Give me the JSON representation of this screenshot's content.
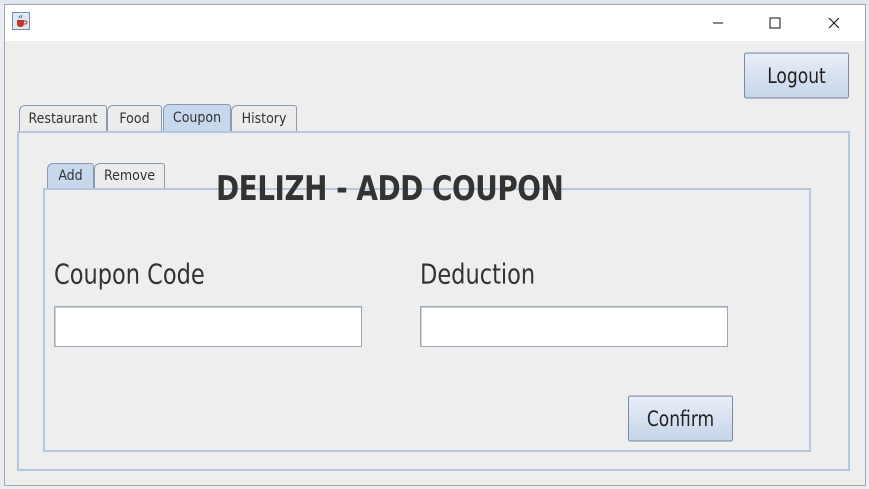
{
  "window": {
    "title": "",
    "controls": [
      "minimize-icon",
      "maximize-icon",
      "close-icon"
    ]
  },
  "header": {
    "logout_label": "Logout"
  },
  "main_tabs": [
    {
      "label": "Restaurant",
      "selected": false
    },
    {
      "label": "Food",
      "selected": false
    },
    {
      "label": "Coupon",
      "selected": true
    },
    {
      "label": "History",
      "selected": false
    }
  ],
  "sub_tabs": [
    {
      "label": "Add",
      "selected": true
    },
    {
      "label": "Remove",
      "selected": false
    }
  ],
  "form": {
    "heading": "DELIZH - ADD COUPON",
    "coupon_code_label": "Coupon Code",
    "coupon_code_value": "",
    "deduction_label": "Deduction",
    "deduction_value": "",
    "confirm_label": "Confirm"
  },
  "colors": {
    "tab_selected": "#c7d8ed",
    "panel_border": "#b5c6df",
    "button_gradient_top": "#e8eef7",
    "button_gradient_bottom": "#c6d5e9"
  }
}
